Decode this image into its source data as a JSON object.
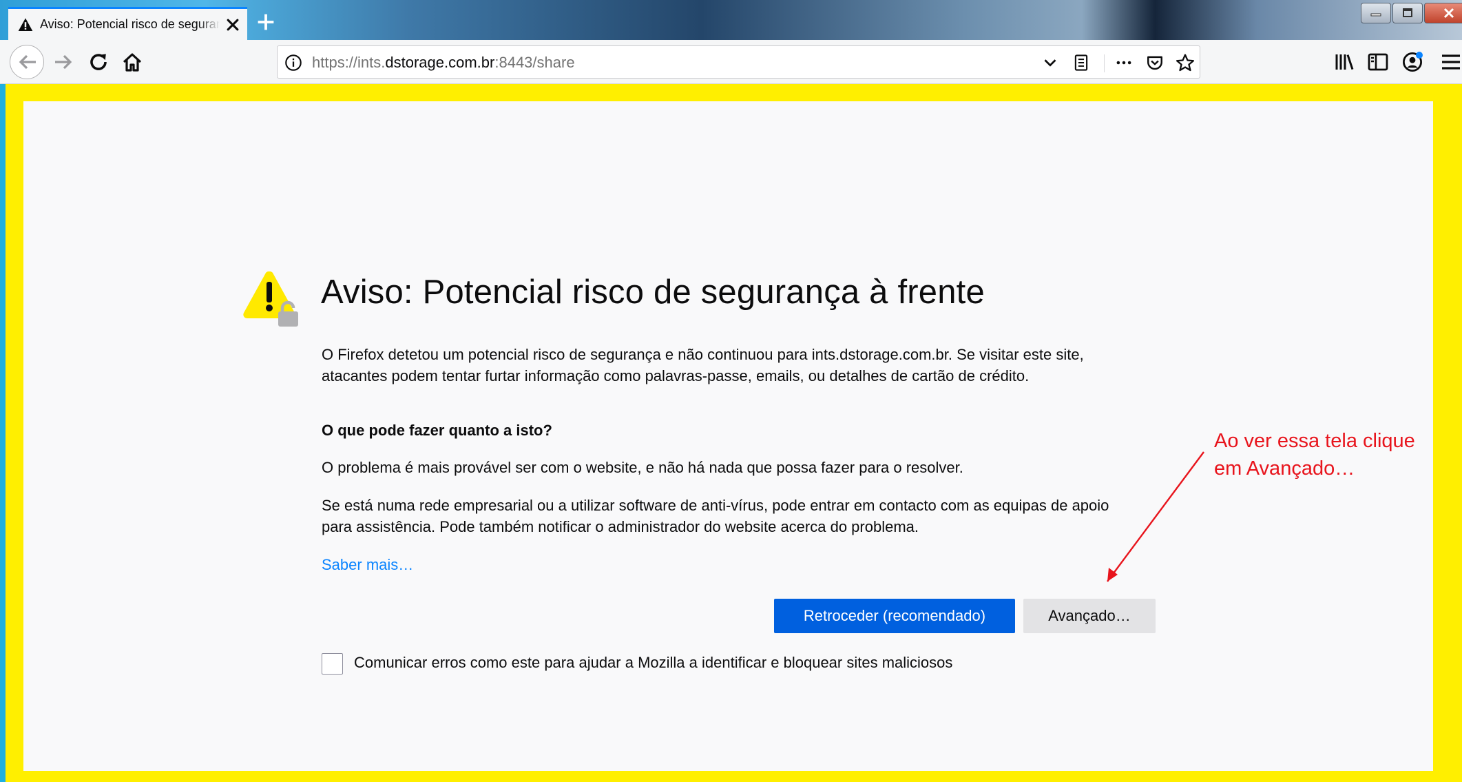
{
  "browser": {
    "tab": {
      "title": "Aviso: Potencial risco de segurança à frente",
      "icon": "warning-icon",
      "close_icon": "close-icon"
    },
    "new_tab_icon": "plus-icon",
    "window_controls": [
      "minimize-icon",
      "maximize-icon",
      "close-icon"
    ],
    "nav": {
      "back_icon": "arrow-left-icon",
      "forward_icon": "arrow-right-icon",
      "reload_icon": "reload-icon",
      "home_icon": "home-icon"
    },
    "url": {
      "prefix": "https://ints.",
      "host": "dstorage.com.br",
      "suffix": ":8443/share"
    },
    "toolbar_icons": [
      "chevron-down-icon",
      "reader-mode-icon",
      "more-actions-icon",
      "pocket-icon",
      "bookmark-star-icon",
      "library-icon",
      "sidebar-icon",
      "account-icon",
      "menu-icon"
    ]
  },
  "page": {
    "title": "Aviso: Potencial risco de segurança à frente",
    "intro_line1": "O Firefox detetou um potencial risco de segurança e não continuou para ints.dstorage.com.br. Se visitar este site,",
    "intro_line2": "atacantes podem tentar furtar informação como palavras-passe, emails, ou detalhes de cartão de crédito.",
    "what_heading": "O que pode fazer quanto a isto?",
    "problem_text": "O problema é mais provável ser com o website, e não há nada que possa fazer para o resolver.",
    "enterprise_line1": "Se está numa rede empresarial ou a utilizar software de anti-vírus, pode entrar em contacto com as equipas de apoio",
    "enterprise_line2": "para assistência. Pode também notificar o administrador do website acerca do problema.",
    "learn_more": "Saber mais…",
    "go_back_button": "Retroceder (recomendado)",
    "advanced_button": "Avançado…",
    "report_checkbox_label": "Comunicar erros como este para ajudar a Mozilla a identificar e bloquear sites maliciosos",
    "report_checked": false
  },
  "annotation": {
    "text": "Ao ver essa tela clique\nem Avançado…",
    "color": "#e8141c"
  },
  "colors": {
    "highlight_frame": "#ffef00",
    "primary_button": "#0060df",
    "link": "#0a84ff"
  }
}
